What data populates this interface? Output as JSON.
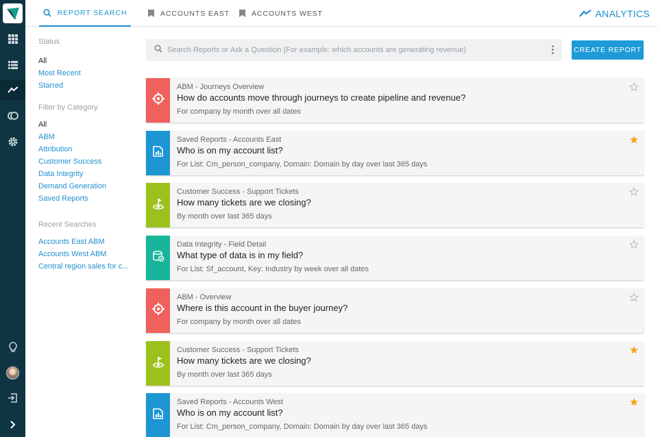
{
  "colors": {
    "accent": "#1e8fcf",
    "abm": "#f0605c",
    "saved": "#1d96d3",
    "support": "#9dc11c",
    "integrity": "#18b59a",
    "star_on": "#f5a623"
  },
  "tabs": [
    {
      "label": "REPORT SEARCH",
      "icon": "search-icon"
    },
    {
      "label": "ACCOUNTS EAST",
      "icon": "bookmark-icon"
    },
    {
      "label": "ACCOUNTS WEST",
      "icon": "bookmark-icon"
    }
  ],
  "analytics_label": "ANALYTICS",
  "filters": {
    "status_heading": "Status",
    "status": [
      "All",
      "Most Recent",
      "Starred"
    ],
    "category_heading": "Filter by Category",
    "categories": [
      "All",
      "ABM",
      "Attribution",
      "Customer Success",
      "Data Integrity",
      "Demand Generation",
      "Saved Reports"
    ],
    "recent_heading": "Recent Searches",
    "recent": [
      "Accounts East ABM",
      "Accounts West ABM",
      "Central region sales for c..."
    ]
  },
  "search": {
    "placeholder": "Search Reports or Ask a Question (For example: which accounts are generating revenue)"
  },
  "create_label": "CREATE REPORT",
  "cards": [
    {
      "category": "ABM - Journeys Overview",
      "question": "How do accounts move through journeys to create pipeline and revenue?",
      "sub": "For company by month over all dates",
      "starred": false,
      "kind": "abm"
    },
    {
      "category": "Saved Reports - Accounts East",
      "question": "Who is on my account list?",
      "sub": "For List: Cm_person_company, Domain: Domain by day over last 365 days",
      "starred": true,
      "kind": "saved"
    },
    {
      "category": "Customer Success - Support Tickets",
      "question": "How many tickets are we closing?",
      "sub": "By month over last 365 days",
      "starred": false,
      "kind": "support"
    },
    {
      "category": "Data Integrity - Field Detail",
      "question": "What type of data is in my field?",
      "sub": "For List: Sf_account, Key: Industry by week over all dates",
      "starred": false,
      "kind": "integrity"
    },
    {
      "category": "ABM - Overview",
      "question": "Where is this account in the buyer journey?",
      "sub": "For company by month over all dates",
      "starred": false,
      "kind": "abm"
    },
    {
      "category": "Customer Success - Support Tickets",
      "question": "How many tickets are we closing?",
      "sub": "By month over last 365 days",
      "starred": true,
      "kind": "support"
    },
    {
      "category": "Saved Reports - Accounts West",
      "question": "Who is on my account list?",
      "sub": "For List: Cm_person_company, Domain: Domain by day over last 365 days",
      "starred": true,
      "kind": "saved"
    }
  ]
}
